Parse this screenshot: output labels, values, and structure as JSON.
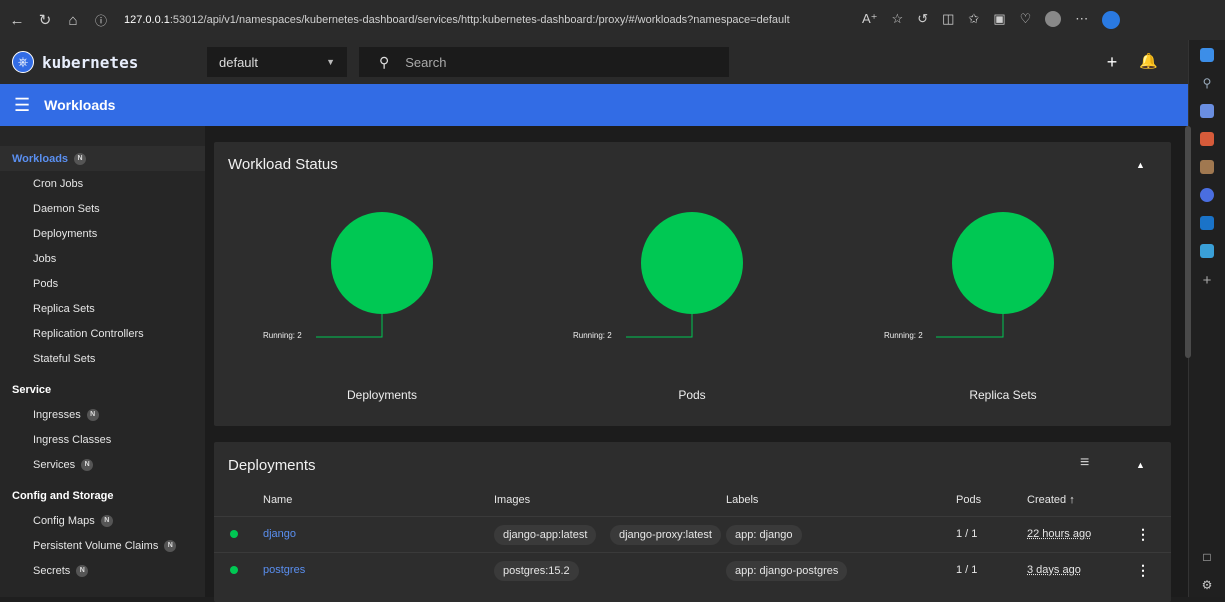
{
  "browser": {
    "url_host": "127.0.0.1",
    "url_rest": ":53012/api/v1/namespaces/kubernetes-dashboard/services/http:kubernetes-dashboard:/proxy/#/workloads?namespace=default"
  },
  "header": {
    "logo_text": "kubernetes",
    "namespace": "default",
    "search_placeholder": "Search"
  },
  "bar": {
    "title": "Workloads"
  },
  "sidebar": {
    "sections": [
      {
        "label": "Workloads",
        "badge": "N",
        "items": [
          "Cron Jobs",
          "Daemon Sets",
          "Deployments",
          "Jobs",
          "Pods",
          "Replica Sets",
          "Replication Controllers",
          "Stateful Sets"
        ]
      },
      {
        "label": "Service",
        "items": [
          "Ingresses",
          "Ingress Classes",
          "Services"
        ]
      },
      {
        "label": "Config and Storage",
        "items": [
          "Config Maps",
          "Persistent Volume Claims",
          "Secrets"
        ]
      }
    ],
    "item_badges": {
      "Ingresses": "N",
      "Services": "N",
      "Config Maps": "N",
      "Persistent Volume Claims": "N",
      "Secrets": "N"
    }
  },
  "workload_status": {
    "title": "Workload Status",
    "charts": [
      {
        "name": "Deployments",
        "running_label": "Running: 2",
        "running": 2
      },
      {
        "name": "Pods",
        "running_label": "Running: 2",
        "running": 2
      },
      {
        "name": "Replica Sets",
        "running_label": "Running: 2",
        "running": 2
      }
    ]
  },
  "deployments": {
    "title": "Deployments",
    "columns": [
      "Name",
      "Images",
      "Labels",
      "Pods",
      "Created ↑"
    ],
    "rows": [
      {
        "name": "django",
        "images": [
          "django-app:latest",
          "django-proxy:latest"
        ],
        "labels": [
          "app: django"
        ],
        "pods": "1 / 1",
        "created": "22 hours ago"
      },
      {
        "name": "postgres",
        "images": [
          "postgres:15.2"
        ],
        "labels": [
          "app: django-postgres"
        ],
        "pods": "1 / 1",
        "created": "3 days ago"
      }
    ]
  },
  "colors": {
    "accent": "#326ce5",
    "running": "#00c853",
    "link": "#5a8ff0"
  }
}
